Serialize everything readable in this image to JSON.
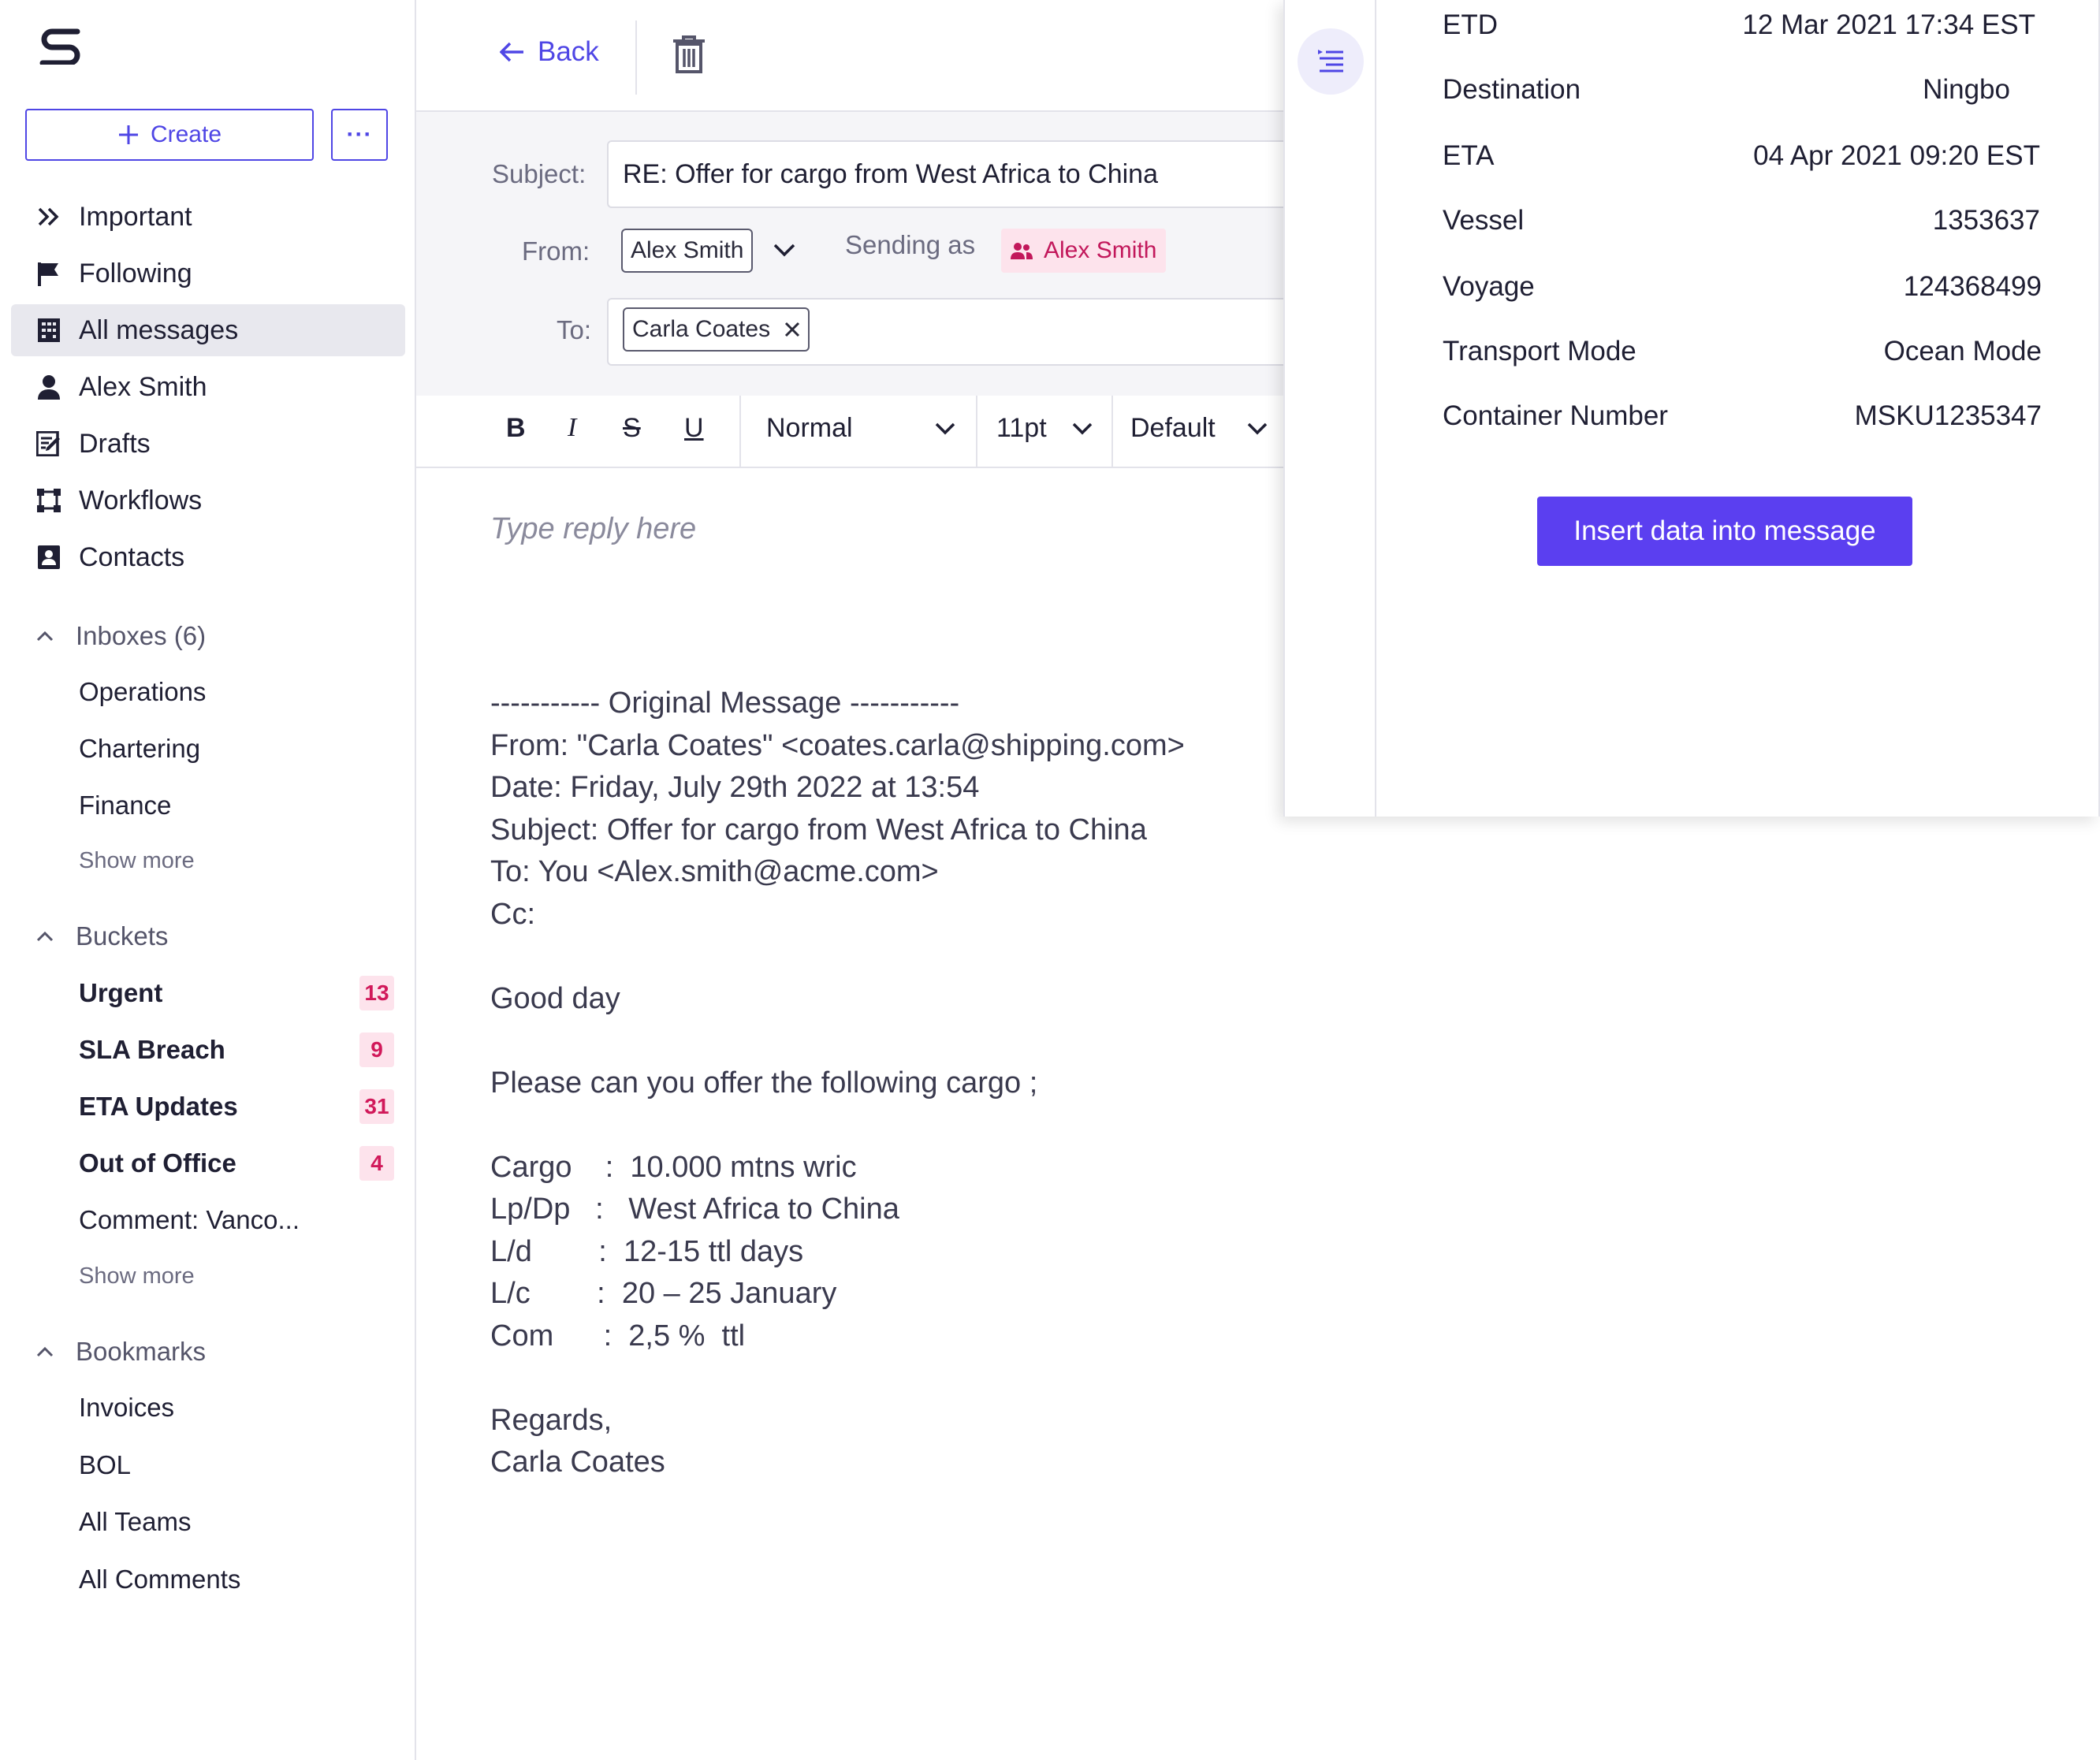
{
  "sidebar": {
    "create_label": "Create",
    "more_label": "···",
    "nav": [
      {
        "label": "Important",
        "icon": "double-chevron-right-icon"
      },
      {
        "label": "Following",
        "icon": "flag-icon"
      },
      {
        "label": "All messages",
        "icon": "building-icon",
        "active": true
      },
      {
        "label": "Alex Smith",
        "icon": "person-icon"
      },
      {
        "label": "Drafts",
        "icon": "edit-document-icon"
      },
      {
        "label": "Workflows",
        "icon": "workflow-icon"
      },
      {
        "label": "Contacts",
        "icon": "contact-card-icon"
      }
    ],
    "inboxes": {
      "title": "Inboxes (6)",
      "items": [
        "Operations",
        "Chartering",
        "Finance"
      ],
      "show_more": "Show more"
    },
    "buckets": {
      "title": "Buckets",
      "items": [
        {
          "label": "Urgent",
          "count": "13"
        },
        {
          "label": "SLA Breach",
          "count": "9"
        },
        {
          "label": "ETA Updates",
          "count": "31"
        },
        {
          "label": "Out of Office",
          "count": "4"
        },
        {
          "label": "Comment: Vanco..."
        }
      ],
      "show_more": "Show more"
    },
    "bookmarks": {
      "title": "Bookmarks",
      "items": [
        "Invoices",
        "BOL",
        "All Teams",
        "All Comments"
      ]
    }
  },
  "compose": {
    "back_label": "Back",
    "subject_label": "Subject:",
    "subject_value": "RE: Offer for cargo from West Africa to China",
    "from_label": "From:",
    "from_value": "Alex Smith",
    "sending_as_label": "Sending as",
    "sending_as_value": "Alex Smith",
    "to_label": "To:",
    "to_value": "Carla Coates",
    "format": {
      "bold": "B",
      "italic": "I",
      "strike": "S",
      "underline": "U",
      "style": "Normal",
      "size": "11pt",
      "font": "Default"
    },
    "placeholder": "Type reply here",
    "original_message": "----------- Original Message -----------\nFrom: \"Carla Coates\" <coates.carla@shipping.com>\nDate: Friday, July 29th 2022 at 13:54\nSubject: Offer for cargo from West Africa to China\nTo: You <Alex.smith@acme.com>\nCc:\n\nGood day\n\nPlease can you offer the following cargo ;\n\nCargo    :  10.000 mtns wric\nLp/Dp   :   West Africa to China\nL/d        :  12-15 ttl days\nL/c        :  20 – 25 January\nCom      :  2,5 %  ttl\n\nRegards,\nCarla Coates"
  },
  "panel": {
    "rows": [
      {
        "label": "ETD",
        "value": "12 Mar 2021 17:34 EST"
      },
      {
        "label": "Destination",
        "value": "Ningbo"
      },
      {
        "label": "ETA",
        "value": "04 Apr 2021 09:20 EST"
      },
      {
        "label": "Vessel",
        "value": "1353637"
      },
      {
        "label": "Voyage",
        "value": "124368499"
      },
      {
        "label": "Transport Mode",
        "value": "Ocean Mode"
      },
      {
        "label": "Container Number",
        "value": "MSKU1235347"
      }
    ],
    "insert_label": "Insert data into message"
  },
  "colors": {
    "accent": "#4f46e5",
    "badge_bg": "#fde3ec",
    "badge_text": "#d1195a",
    "insert_button": "#5b3ff0"
  }
}
